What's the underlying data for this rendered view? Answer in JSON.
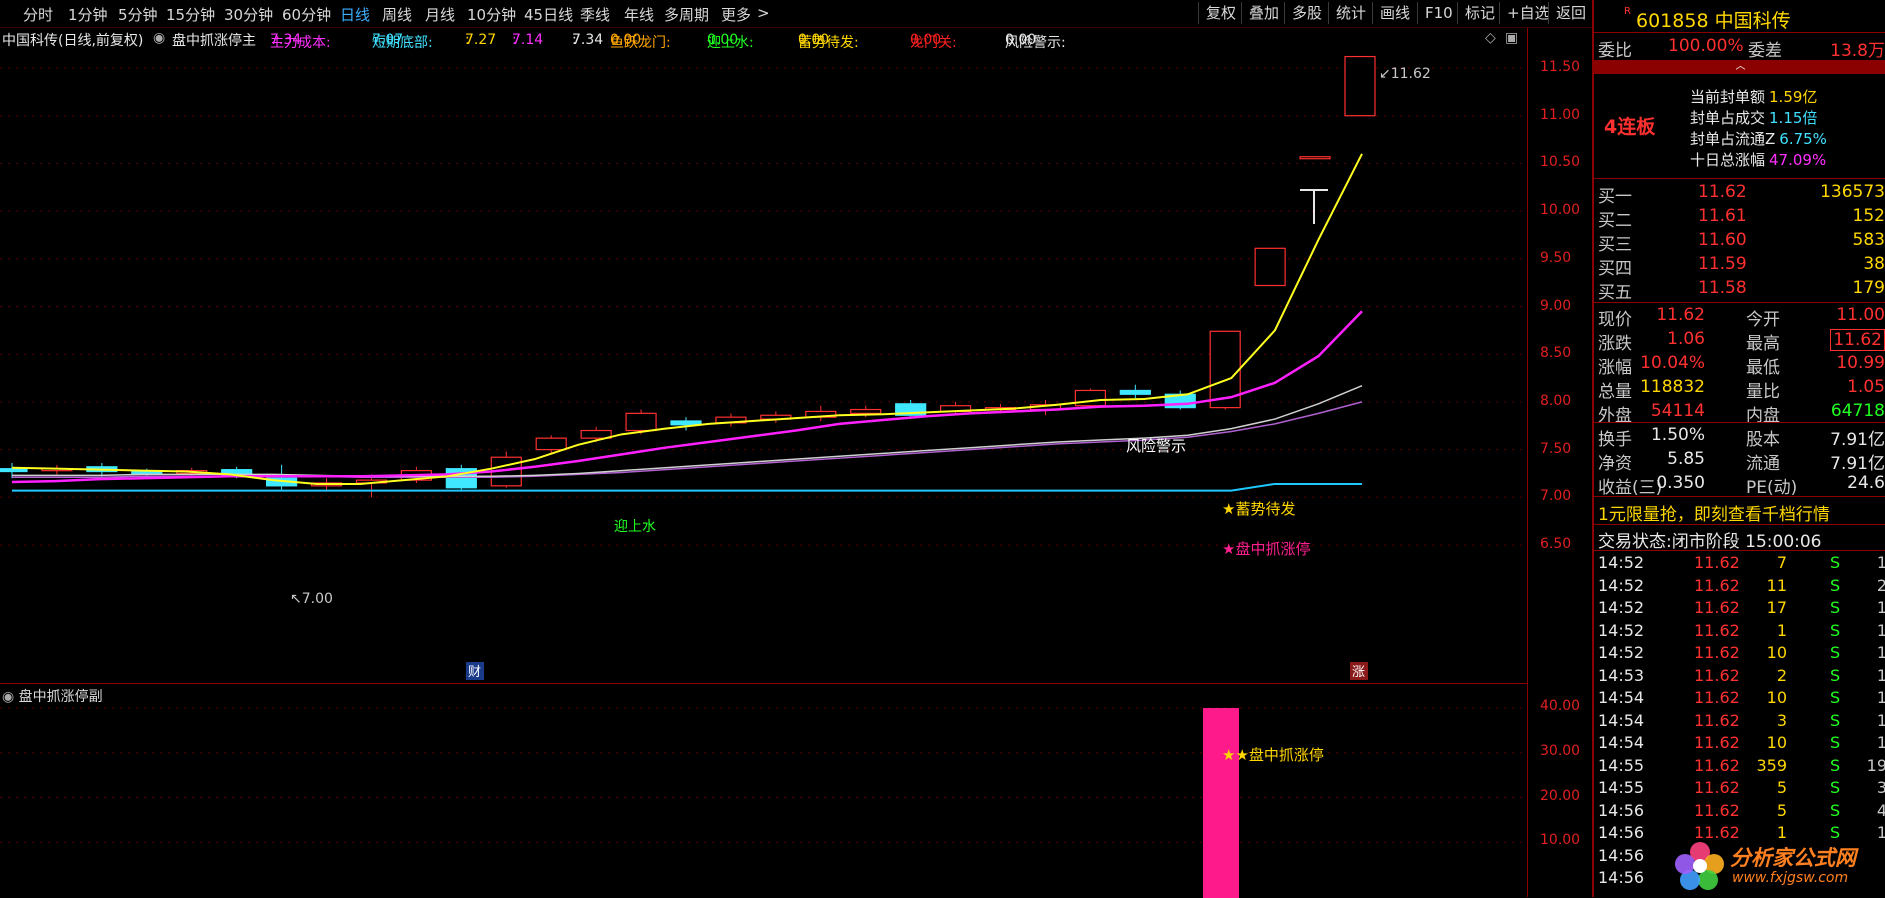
{
  "toolbar": {
    "periods": [
      "分时",
      "1分钟",
      "5分钟",
      "15分钟",
      "30分钟",
      "60分钟",
      "日线",
      "周线",
      "月线",
      "10分钟",
      "45日线",
      "季线",
      "年线",
      "多周期",
      "更多"
    ],
    "active_period": "日线",
    "more_arrow": ">",
    "right_buttons": [
      "复权",
      "叠加",
      "多股",
      "统计",
      "画线",
      "F10",
      "标记",
      "+自选",
      "返回"
    ]
  },
  "indicator_bar": {
    "stock_label": "中国科传(日线,前复权)",
    "formula_name": "盘中抓涨停主",
    "items": [
      {
        "label": "主力成本:",
        "value": "7.34",
        "color": "#ff30ff"
      },
      {
        "label": "短期底部:",
        "value": "7.07",
        "color": "#40e0ff"
      },
      {
        "label": ":",
        "value": "7.27",
        "color": "#ffd700"
      },
      {
        "label": ":",
        "value": "7.14",
        "color": "#ff30ff"
      },
      {
        "label": ":",
        "value": "7.34",
        "color": "#e8e8e8"
      },
      {
        "label": "鱼跃龙门:",
        "value": "0.00",
        "color": "#ffa500"
      },
      {
        "label": "迎上水:",
        "value": "0.00",
        "color": "#20ff20"
      },
      {
        "label": "蓄势待发:",
        "value": "0.00",
        "color": "#ffd700"
      },
      {
        "label": "龙门关:",
        "value": "0.00",
        "color": "#ff2020"
      },
      {
        "label": "风险警示:",
        "value": "0.00",
        "color": "#e8e8e8"
      }
    ]
  },
  "main_chart": {
    "y_ticks": [
      "11.50",
      "11.00",
      "10.50",
      "10.00",
      "9.50",
      "9.00",
      "8.50",
      "8.00",
      "7.50",
      "7.00",
      "6.50"
    ],
    "annotations": {
      "high_label": "11.62",
      "low_label": "7.00",
      "risk_warning": "风险警示",
      "yingshangshui": "迎上水",
      "xushi": "★蓄势待发",
      "zhuazhangting": "★盘中抓涨停",
      "cai_marker": "财",
      "zhang_marker": "涨"
    },
    "candles": [
      {
        "o": 7.3,
        "c": 7.27,
        "h": 7.36,
        "l": 7.2
      },
      {
        "o": 7.28,
        "c": 7.3,
        "h": 7.34,
        "l": 7.24
      },
      {
        "o": 7.32,
        "c": 7.27,
        "h": 7.36,
        "l": 7.22
      },
      {
        "o": 7.27,
        "c": 7.25,
        "h": 7.3,
        "l": 7.2
      },
      {
        "o": 7.25,
        "c": 7.28,
        "h": 7.31,
        "l": 7.22
      },
      {
        "o": 7.29,
        "c": 7.23,
        "h": 7.32,
        "l": 7.2
      },
      {
        "o": 7.2,
        "c": 7.12,
        "h": 7.34,
        "l": 7.08
      },
      {
        "o": 7.12,
        "c": 7.15,
        "h": 7.2,
        "l": 7.06
      },
      {
        "o": 7.15,
        "c": 7.18,
        "h": 7.24,
        "l": 7.0
      },
      {
        "o": 7.18,
        "c": 7.28,
        "h": 7.32,
        "l": 7.15
      },
      {
        "o": 7.3,
        "c": 7.1,
        "h": 7.34,
        "l": 7.06
      },
      {
        "o": 7.12,
        "c": 7.42,
        "h": 7.48,
        "l": 7.1
      },
      {
        "o": 7.5,
        "c": 7.62,
        "h": 7.65,
        "l": 7.45
      },
      {
        "o": 7.62,
        "c": 7.7,
        "h": 7.74,
        "l": 7.58
      },
      {
        "o": 7.7,
        "c": 7.88,
        "h": 7.92,
        "l": 7.66
      },
      {
        "o": 7.8,
        "c": 7.76,
        "h": 7.84,
        "l": 7.7
      },
      {
        "o": 7.78,
        "c": 7.84,
        "h": 7.88,
        "l": 7.74
      },
      {
        "o": 7.82,
        "c": 7.86,
        "h": 7.9,
        "l": 7.78
      },
      {
        "o": 7.84,
        "c": 7.9,
        "h": 7.96,
        "l": 7.8
      },
      {
        "o": 7.88,
        "c": 7.92,
        "h": 7.96,
        "l": 7.84
      },
      {
        "o": 7.98,
        "c": 7.86,
        "h": 8.02,
        "l": 7.84
      },
      {
        "o": 7.9,
        "c": 7.96,
        "h": 8.0,
        "l": 7.86
      },
      {
        "o": 7.92,
        "c": 7.94,
        "h": 7.98,
        "l": 7.88
      },
      {
        "o": 7.92,
        "c": 7.97,
        "h": 8.02,
        "l": 7.86
      },
      {
        "o": 7.96,
        "c": 8.12,
        "h": 8.14,
        "l": 7.94
      },
      {
        "o": 8.12,
        "c": 8.08,
        "h": 8.18,
        "l": 8.04
      },
      {
        "o": 8.08,
        "c": 7.94,
        "h": 8.12,
        "l": 7.92
      },
      {
        "o": 7.94,
        "c": 8.74,
        "h": 8.74,
        "l": 7.92
      },
      {
        "o": 9.22,
        "c": 9.61,
        "h": 9.61,
        "l": 9.22
      },
      {
        "o": 10.57,
        "c": 10.57,
        "h": 10.57,
        "l": 10.57
      },
      {
        "o": 11.0,
        "c": 11.62,
        "h": 11.62,
        "l": 11.0
      }
    ],
    "yellow_line": [
      7.31,
      7.3,
      7.29,
      7.28,
      7.27,
      7.24,
      7.18,
      7.14,
      7.14,
      7.18,
      7.22,
      7.3,
      7.4,
      7.55,
      7.66,
      7.72,
      7.77,
      7.8,
      7.83,
      7.86,
      7.87,
      7.89,
      7.91,
      7.93,
      7.97,
      8.02,
      8.03,
      8.08,
      8.25,
      8.75,
      9.7,
      10.6
    ],
    "magenta_line": [
      7.16,
      7.17,
      7.19,
      7.2,
      7.21,
      7.22,
      7.22,
      7.22,
      7.22,
      7.23,
      7.24,
      7.27,
      7.32,
      7.38,
      7.45,
      7.52,
      7.58,
      7.64,
      7.7,
      7.77,
      7.81,
      7.85,
      7.88,
      7.9,
      7.92,
      7.95,
      7.96,
      7.98,
      8.05,
      8.2,
      8.48,
      8.95
    ],
    "white_line": [
      7.23,
      7.23,
      7.23,
      7.24,
      7.24,
      7.24,
      7.24,
      7.23,
      7.22,
      7.22,
      7.22,
      7.22,
      7.23,
      7.25,
      7.28,
      7.31,
      7.34,
      7.37,
      7.4,
      7.43,
      7.46,
      7.49,
      7.52,
      7.55,
      7.58,
      7.6,
      7.62,
      7.65,
      7.72,
      7.82,
      7.98,
      8.17
    ],
    "purple_line": [
      7.21,
      7.21,
      7.21,
      7.22,
      7.22,
      7.22,
      7.22,
      7.22,
      7.21,
      7.21,
      7.21,
      7.21,
      7.22,
      7.24,
      7.26,
      7.29,
      7.32,
      7.35,
      7.38,
      7.41,
      7.44,
      7.47,
      7.5,
      7.53,
      7.56,
      7.58,
      7.6,
      7.63,
      7.69,
      7.77,
      7.88,
      8.0
    ],
    "cyan_line": [
      7.07,
      7.07,
      7.07,
      7.07,
      7.07,
      7.07,
      7.07,
      7.07,
      7.07,
      7.07,
      7.07,
      7.07,
      7.07,
      7.07,
      7.07,
      7.07,
      7.07,
      7.07,
      7.07,
      7.07,
      7.07,
      7.07,
      7.07,
      7.07,
      7.07,
      7.07,
      7.07,
      7.07,
      7.07,
      7.14,
      7.14,
      7.14
    ]
  },
  "sub_chart": {
    "title": "盘中抓涨停副",
    "y_ticks": [
      "40.00",
      "30.00",
      "20.00",
      "10.00"
    ],
    "bar_value": 40,
    "bar_label": "★★盘中抓涨停"
  },
  "quote": {
    "code_flag": "R",
    "code": "601858",
    "name": "中国科传",
    "weibi_label": "委比",
    "weibi": "100.00%",
    "weicha_label": "委差",
    "weicha": "13.8万",
    "lianban": "4连板",
    "seal_items": [
      {
        "label": "当前封单额",
        "value": "1.59亿",
        "color": "#ffd700"
      },
      {
        "label": "封单占成交",
        "value": "1.15倍",
        "color": "#40e0ff"
      },
      {
        "label": "封单占流通Z",
        "value": "6.75%",
        "color": "#40e0ff"
      },
      {
        "label": "十日总涨幅",
        "value": "47.09%",
        "color": "#ff30ff"
      }
    ],
    "bids": [
      {
        "label": "买一",
        "price": "11.62",
        "vol": "136573"
      },
      {
        "label": "买二",
        "price": "11.61",
        "vol": "152"
      },
      {
        "label": "买三",
        "price": "11.60",
        "vol": "583"
      },
      {
        "label": "买四",
        "price": "11.59",
        "vol": "38"
      },
      {
        "label": "买五",
        "price": "11.58",
        "vol": "179"
      }
    ],
    "stats": [
      {
        "l1": "现价",
        "v1": "11.62",
        "c1": "#ff3030",
        "l2": "今开",
        "v2": "11.00",
        "c2": "#ff3030"
      },
      {
        "l1": "涨跌",
        "v1": "1.06",
        "c1": "#ff3030",
        "l2": "最高",
        "v2": "11.62",
        "c2": "#ff3030"
      },
      {
        "l1": "涨幅",
        "v1": "10.04%",
        "c1": "#ff3030",
        "l2": "最低",
        "v2": "10.99",
        "c2": "#ff3030"
      },
      {
        "l1": "总量",
        "v1": "118832",
        "c1": "#ffd700",
        "l2": "量比",
        "v2": "1.05",
        "c2": "#ff3030"
      },
      {
        "l1": "外盘",
        "v1": "54114",
        "c1": "#ff3030",
        "l2": "内盘",
        "v2": "64718",
        "c2": "#20ff20"
      }
    ],
    "stats2": [
      {
        "l1": "换手",
        "v1": "1.50%",
        "l2": "股本",
        "v2": "7.91亿"
      },
      {
        "l1": "净资",
        "v1": "5.85",
        "l2": "流通",
        "v2": "7.91亿"
      },
      {
        "l1": "收益(三)",
        "v1": "0.350",
        "l2": "PE(动)",
        "v2": "24.6"
      }
    ],
    "promo": "1元限量抢，即刻查看千档行情",
    "trade_status_label": "交易状态:",
    "trade_status": "闭市阶段 15:00:06",
    "trades": [
      {
        "t": "14:52",
        "p": "11.62",
        "v": "7",
        "s": "S",
        "n": "1"
      },
      {
        "t": "14:52",
        "p": "11.62",
        "v": "11",
        "s": "S",
        "n": "2"
      },
      {
        "t": "14:52",
        "p": "11.62",
        "v": "17",
        "s": "S",
        "n": "1"
      },
      {
        "t": "14:52",
        "p": "11.62",
        "v": "1",
        "s": "S",
        "n": "1"
      },
      {
        "t": "14:52",
        "p": "11.62",
        "v": "10",
        "s": "S",
        "n": "1"
      },
      {
        "t": "14:53",
        "p": "11.62",
        "v": "2",
        "s": "S",
        "n": "1"
      },
      {
        "t": "14:54",
        "p": "11.62",
        "v": "10",
        "s": "S",
        "n": "1"
      },
      {
        "t": "14:54",
        "p": "11.62",
        "v": "3",
        "s": "S",
        "n": "1"
      },
      {
        "t": "14:54",
        "p": "11.62",
        "v": "10",
        "s": "S",
        "n": "1"
      },
      {
        "t": "14:55",
        "p": "11.62",
        "v": "359",
        "s": "S",
        "n": "19"
      },
      {
        "t": "14:55",
        "p": "11.62",
        "v": "5",
        "s": "S",
        "n": "3"
      },
      {
        "t": "14:56",
        "p": "11.62",
        "v": "5",
        "s": "S",
        "n": "4"
      },
      {
        "t": "14:56",
        "p": "11.62",
        "v": "1",
        "s": "S",
        "n": "1"
      },
      {
        "t": "14:56",
        "p": "",
        "v": "",
        "s": "",
        "n": ""
      },
      {
        "t": "14:56",
        "p": "",
        "v": "",
        "s": "",
        "n": ""
      }
    ],
    "logo_text": "分析家公式网",
    "logo_url": "www.fxjgsw.com"
  }
}
